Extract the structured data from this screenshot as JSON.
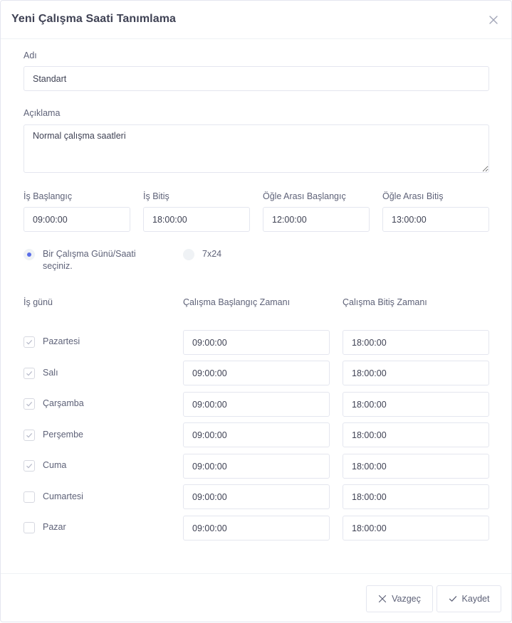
{
  "dialog": {
    "title": "Yeni Çalışma Saati Tanımlama"
  },
  "form": {
    "name": {
      "label": "Adı",
      "value": "Standart"
    },
    "description": {
      "label": "Açıklama",
      "value": "Normal çalışma saatleri"
    },
    "work_start": {
      "label": "İş Başlangıç",
      "value": "09:00:00"
    },
    "work_end": {
      "label": "İş Bitiş",
      "value": "18:00:00"
    },
    "lunch_start": {
      "label": "Öğle Arası Başlangıç",
      "value": "12:00:00"
    },
    "lunch_end": {
      "label": "Öğle Arası Bitiş",
      "value": "13:00:00"
    }
  },
  "mode": {
    "option_custom": {
      "label_line1": "Bir Çalışma Günü/Saati",
      "label_line2": "seçiniz.",
      "checked": true
    },
    "option_247": {
      "label": "7x24",
      "checked": false
    }
  },
  "schedule": {
    "headers": {
      "day": "İş günü",
      "start": "Çalışma Başlangıç Zamanı",
      "end": "Çalışma Bitiş Zamanı"
    },
    "days": [
      {
        "name": "Pazartesi",
        "checked": true,
        "start": "09:00:00",
        "end": "18:00:00"
      },
      {
        "name": "Salı",
        "checked": true,
        "start": "09:00:00",
        "end": "18:00:00"
      },
      {
        "name": "Çarşamba",
        "checked": true,
        "start": "09:00:00",
        "end": "18:00:00"
      },
      {
        "name": "Perşembe",
        "checked": true,
        "start": "09:00:00",
        "end": "18:00:00"
      },
      {
        "name": "Cuma",
        "checked": true,
        "start": "09:00:00",
        "end": "18:00:00"
      },
      {
        "name": "Cumartesi",
        "checked": false,
        "start": "09:00:00",
        "end": "18:00:00"
      },
      {
        "name": "Pazar",
        "checked": false,
        "start": "09:00:00",
        "end": "18:00:00"
      }
    ]
  },
  "footer": {
    "cancel_label": "Vazgeç",
    "save_label": "Kaydet"
  },
  "colors": {
    "accent": "#5a6ee8",
    "border": "#e4e6ef",
    "text": "#5e6278"
  }
}
